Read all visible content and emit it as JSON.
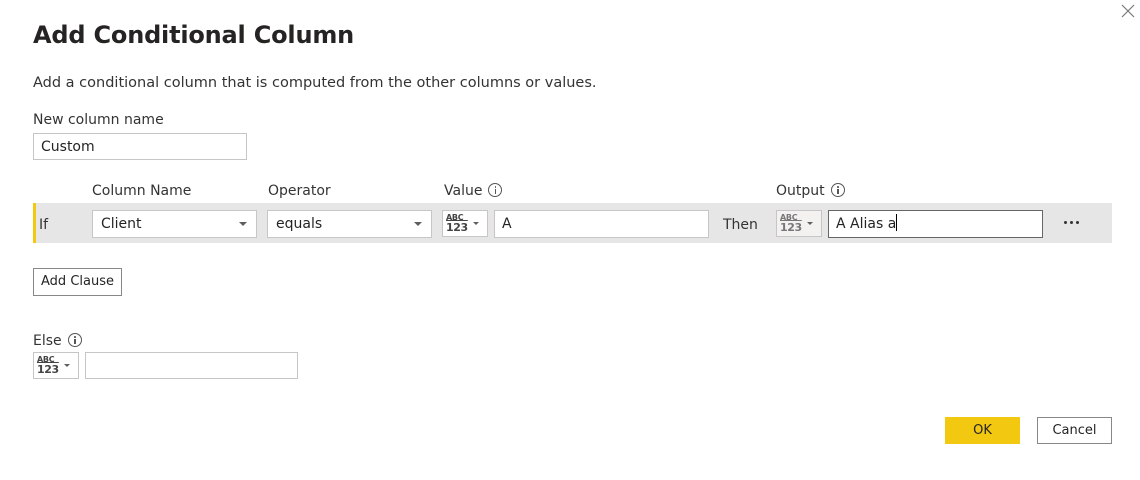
{
  "dialog": {
    "title": "Add Conditional Column",
    "description": "Add a conditional column that is computed from the other columns or values.",
    "close_icon": "close-icon"
  },
  "new_column": {
    "label": "New column name",
    "value": "Custom"
  },
  "headers": {
    "column_name": "Column Name",
    "operator": "Operator",
    "value": "Value",
    "output": "Output"
  },
  "clause": {
    "if_label": "If",
    "column_name": "Client",
    "operator": "equals",
    "value_type_abc": "ABC",
    "value_type_num": "123",
    "value": "A",
    "then_label": "Then",
    "output_type_abc": "ABC",
    "output_type_num": "123",
    "output": "A Alias a",
    "more_icon": "more-options-icon"
  },
  "add_clause_label": "Add Clause",
  "else": {
    "label": "Else",
    "type_abc": "ABC",
    "type_num": "123",
    "value": ""
  },
  "footer": {
    "ok_label": "OK",
    "cancel_label": "Cancel"
  },
  "colors": {
    "accent": "#f2c811",
    "row_background": "#e6e6e6",
    "border": "#c8c6c4"
  }
}
